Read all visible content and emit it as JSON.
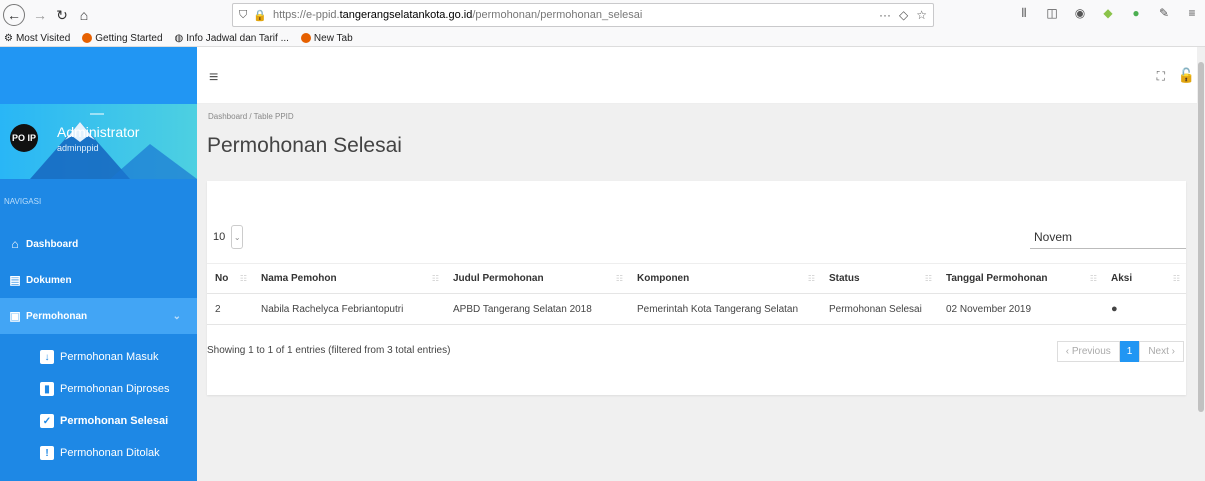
{
  "browser": {
    "url_prefix": "https://e-ppid.",
    "url_host": "tangerangselatankota.go.id",
    "url_path": "/permohonan/permohonan_selesai",
    "bookmarks": [
      {
        "label": "Most Visited",
        "icon": "gear-icon",
        "color": "#555555"
      },
      {
        "label": "Getting Started",
        "icon": "firefox-icon",
        "color": "#e66000"
      },
      {
        "label": "Info Jadwal dan Tarif ...",
        "icon": "globe-icon",
        "color": "#444444"
      },
      {
        "label": "New Tab",
        "icon": "firefox-icon",
        "color": "#e66000"
      }
    ]
  },
  "sidebar": {
    "profile_name": "Administrator",
    "profile_user": "adminppid",
    "avatar_text": "PO IP",
    "nav_heading": "NAVIGASI",
    "items": [
      {
        "label": "Dashboard",
        "icon": "home-icon"
      },
      {
        "label": "Dokumen",
        "icon": "file-plus-icon"
      },
      {
        "label": "Permohonan",
        "icon": "clipboard-icon"
      }
    ],
    "sub_items": [
      {
        "label": "Permohonan Masuk",
        "icon": "inbox-icon"
      },
      {
        "label": "Permohonan Diproses",
        "icon": "bar-chart-icon"
      },
      {
        "label": "Permohonan Selesai",
        "icon": "check-icon"
      },
      {
        "label": "Permohonan Ditolak",
        "icon": "exclamation-icon"
      }
    ]
  },
  "content": {
    "breadcrumb": "Dashboard  /  Table PPID",
    "title": "Permohonan Selesai",
    "page_length": "10",
    "search_value": "Novem",
    "columns": [
      "No",
      "Nama Pemohon",
      "Judul Permohonan",
      "Komponen",
      "Status",
      "Tanggal Permohonan",
      "Aksi"
    ],
    "rows": [
      [
        "2",
        "Nabila Rachelyca Febriantoputri",
        "APBD Tangerang Selatan 2018",
        "Pemerintah Kota Tangerang Selatan",
        "Permohonan Selesai",
        "02 November 2019",
        ""
      ]
    ],
    "info": "Showing 1 to 1 of 1 entries (filtered from 3 total entries)",
    "pager": {
      "previous": "‹ Previous",
      "current": "1",
      "next": "Next ›"
    }
  },
  "colors": {
    "sidebar": "#1e88e5",
    "accent": "#2196f3",
    "background": "#f0f0f0"
  }
}
